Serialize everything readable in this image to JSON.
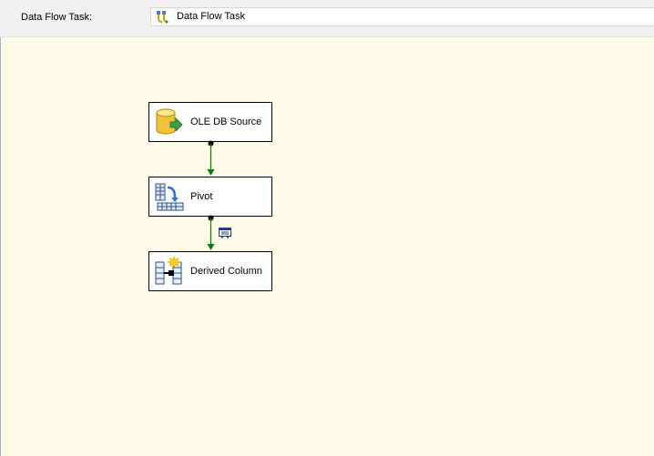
{
  "toolbar": {
    "task_label": "Data Flow Task:",
    "task_value": "Data Flow Task",
    "task_icon": "data-flow-task-icon"
  },
  "components": [
    {
      "label": "OLE DB Source",
      "icon": "database-source-icon"
    },
    {
      "label": "Pivot",
      "icon": "pivot-transform-icon"
    },
    {
      "label": "Derived Column",
      "icon": "derived-column-icon"
    }
  ],
  "colors": {
    "canvas_background": "#fffbe6",
    "path_color": "#008000",
    "selection_border": "#000000"
  }
}
